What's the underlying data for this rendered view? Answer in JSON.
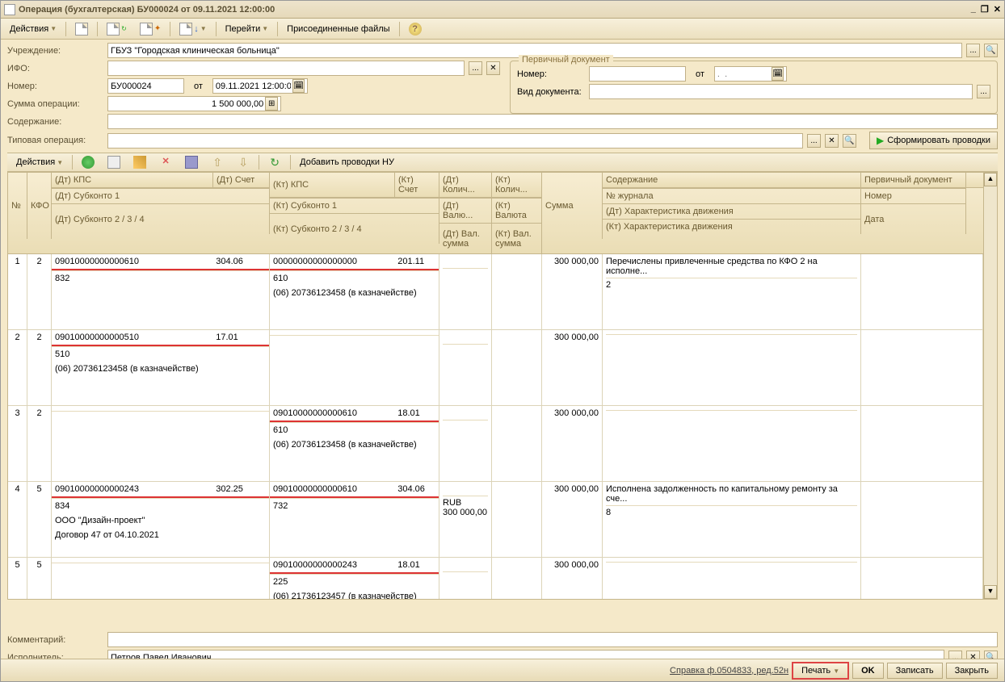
{
  "window": {
    "title": "Операция (бухгалтерская) БУ000024 от 09.11.2021 12:00:00"
  },
  "toolbar": {
    "actions": "Действия",
    "goto": "Перейти",
    "files": "Присоединенные файлы"
  },
  "form": {
    "org_lbl": "Учреждение:",
    "org": "ГБУЗ \"Городская клиническая больница\"",
    "ifo_lbl": "ИФО:",
    "ifo": "",
    "num_lbl": "Номер:",
    "num": "БУ000024",
    "from": "от",
    "date": "09.11.2021 12:00:00",
    "sum_lbl": "Сумма операции:",
    "sum": "1 500 000,00",
    "content_lbl": "Содержание:",
    "content": "",
    "typical_lbl": "Типовая операция:",
    "typical": "",
    "form_btn": "Сформировать проводки",
    "comment_lbl": "Комментарий:",
    "comment": "",
    "exec_lbl": "Исполнитель:",
    "exec": "Петров Павел Иванович"
  },
  "primary": {
    "legend": "Первичный документ",
    "num_lbl": "Номер:",
    "from": "от",
    "date_ph": ".  .",
    "type_lbl": "Вид документа:"
  },
  "toolbar2": {
    "actions": "Действия",
    "add_nu": "Добавить проводки НУ"
  },
  "headers": {
    "num": "№",
    "kfo": "КФО",
    "dt_kps": "(Дт) КПС",
    "dt_sch": "(Дт) Счет",
    "kt_kps": "(Кт) КПС",
    "kt_sch": "(Кт) Счет",
    "dt_kol": "(Дт) Колич...",
    "kt_kol": "(Кт) Колич...",
    "sum": "Сумма",
    "sod": "Содержание",
    "prim": "Первичный документ",
    "dt_sub1": "(Дт) Субконто 1",
    "kt_sub1": "(Кт) Субконто 1",
    "dt_val": "(Дт) Валю...",
    "kt_val": "(Кт) Валюта",
    "njur": "№ журнала",
    "nomer": "Номер",
    "dt_sub234": "(Дт) Субконто 2 / 3 / 4",
    "kt_sub234": "(Кт) Субконто 2 / 3 / 4",
    "dt_vsum": "(Дт) Вал. сумма",
    "kt_vsum": "(Кт) Вал. сумма",
    "dt_har": "(Дт) Характеристика движения",
    "data": "Дата",
    "kt_har": "(Кт) Характеристика движения"
  },
  "rows": [
    {
      "n": "1",
      "kfo": "2",
      "dt_kps": "09010000000000610",
      "dt_sch": "304.06",
      "kt_kps": "00000000000000000",
      "kt_sch": "201.11",
      "sum": "300 000,00",
      "sod": "Перечислены привлеченные средства по КФО 2 на исполне...",
      "dt_sub1": "832",
      "kt_sub1": "610",
      "njur": "2",
      "kt_sub2": "(06) 20736123458 (в казначействе)"
    },
    {
      "n": "2",
      "kfo": "2",
      "dt_kps": "09010000000000510",
      "dt_sch": "17.01",
      "sum": "300 000,00",
      "dt_sub1": "510",
      "dt_sub2": "(06) 20736123458 (в казначействе)"
    },
    {
      "n": "3",
      "kfo": "2",
      "kt_kps": "09010000000000610",
      "kt_sch": "18.01",
      "sum": "300 000,00",
      "kt_sub1": "610",
      "kt_sub2": "(06) 20736123458 (в казначействе)"
    },
    {
      "n": "4",
      "kfo": "5",
      "dt_kps": "09010000000000243",
      "dt_sch": "302.25",
      "kt_kps": "09010000000000610",
      "kt_sch": "304.06",
      "sum": "300 000,00",
      "sod": "Исполнена задолженность по капитальному ремонту за сче...",
      "dt_sub1": "834",
      "kt_sub1": "732",
      "dt_val": "RUB",
      "njur": "8",
      "dt_sub2": "ООО \"Дизайн-проект\"",
      "dt_vsum": "300 000,00",
      "dt_sub3": "Договор 47 от 04.10.2021"
    },
    {
      "n": "5",
      "kfo": "5",
      "kt_kps": "09010000000000243",
      "kt_sch": "18.01",
      "sum": "300 000,00",
      "kt_sub1": "225",
      "kt_sub2": "(06) 21736123457 (в казначействе)"
    }
  ],
  "footer": {
    "help": "Справка ф.0504833, ред.52н",
    "print": "Печать",
    "ok": "OK",
    "save": "Записать",
    "close": "Закрыть"
  }
}
